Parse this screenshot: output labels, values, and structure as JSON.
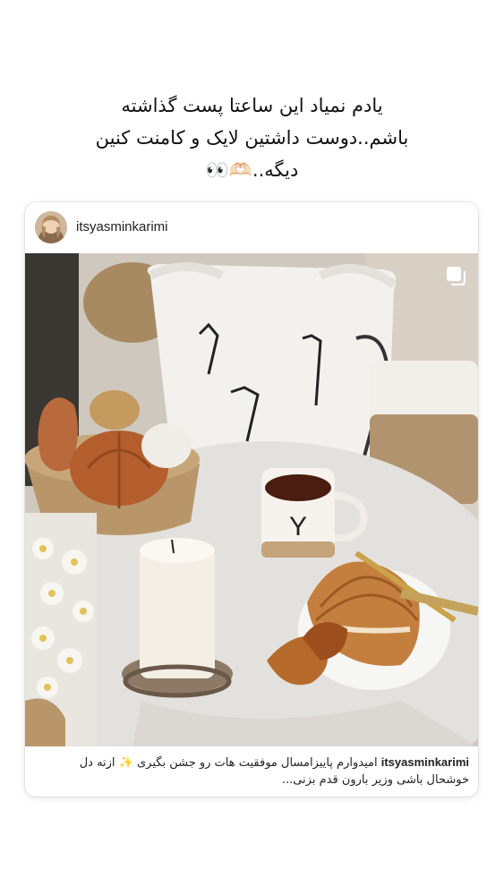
{
  "story": {
    "lines": [
      "یادم نمیاد این ساعتا پست گذاشته",
      "باشم..دوست داشتین لایک و کامنت کنین",
      "دیگه..🫶🏻👀"
    ]
  },
  "post": {
    "username": "itsyasminkarimi",
    "avatar_icon": "profile-avatar",
    "media_icon": "multiple-posts-icon",
    "caption_user": "itsyasminkarimi",
    "caption_text": "امیدوارم پاییزامسال موفقیت هات رو جشن بگیری ✨ ازته دل خوشحال باشی وزیر بارون قدم بزنی...",
    "mug_letter": "Y"
  }
}
